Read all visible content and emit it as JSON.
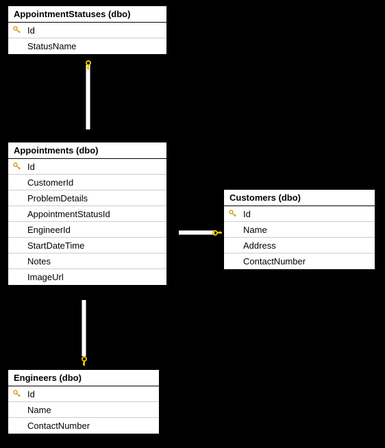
{
  "tables": {
    "appointmentStatuses": {
      "title": "AppointmentStatuses (dbo)",
      "columns": {
        "id": "Id",
        "statusName": "StatusName"
      }
    },
    "appointments": {
      "title": "Appointments (dbo)",
      "columns": {
        "id": "Id",
        "customerId": "CustomerId",
        "problemDetails": "ProblemDetails",
        "appointmentStatusId": "AppointmentStatusId",
        "engineerId": "EngineerId",
        "startDateTime": "StartDateTime",
        "notes": "Notes",
        "imageUrl": "ImageUrl"
      }
    },
    "customers": {
      "title": "Customers (dbo)",
      "columns": {
        "id": "Id",
        "name": "Name",
        "address": "Address",
        "contactNumber": "ContactNumber"
      }
    },
    "engineers": {
      "title": "Engineers (dbo)",
      "columns": {
        "id": "Id",
        "name": "Name",
        "contactNumber": "ContactNumber"
      }
    }
  },
  "relationships": [
    {
      "from": "Appointments.AppointmentStatusId",
      "to": "AppointmentStatuses.Id",
      "type": "many-to-one"
    },
    {
      "from": "Appointments.CustomerId",
      "to": "Customers.Id",
      "type": "many-to-one"
    },
    {
      "from": "Appointments.EngineerId",
      "to": "Engineers.Id",
      "type": "many-to-one"
    }
  ]
}
